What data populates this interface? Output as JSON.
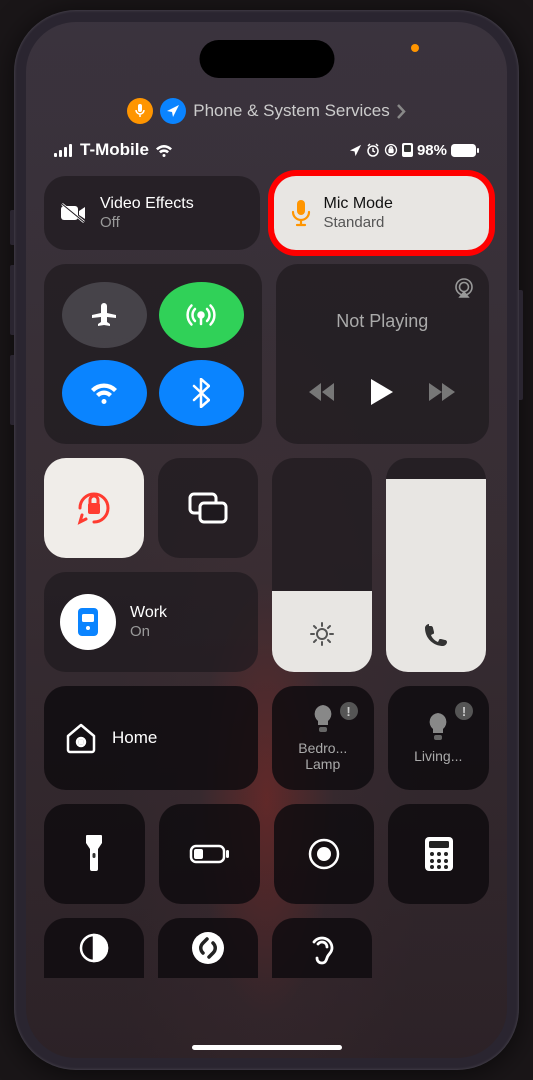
{
  "topBanner": {
    "label": "Phone & System Services"
  },
  "statusBar": {
    "carrier": "T-Mobile",
    "battery": "98%"
  },
  "effects": {
    "video": {
      "title": "Video Effects",
      "sub": "Off"
    },
    "mic": {
      "title": "Mic Mode",
      "sub": "Standard"
    }
  },
  "media": {
    "title": "Not Playing"
  },
  "focus": {
    "title": "Work",
    "sub": "On"
  },
  "sliders": {
    "brightness": 38,
    "volume": 90
  },
  "home": {
    "label": "Home",
    "devices": [
      {
        "line1": "Bedro...",
        "line2": "Lamp"
      },
      {
        "line1": "Living...",
        "line2": ""
      }
    ]
  }
}
